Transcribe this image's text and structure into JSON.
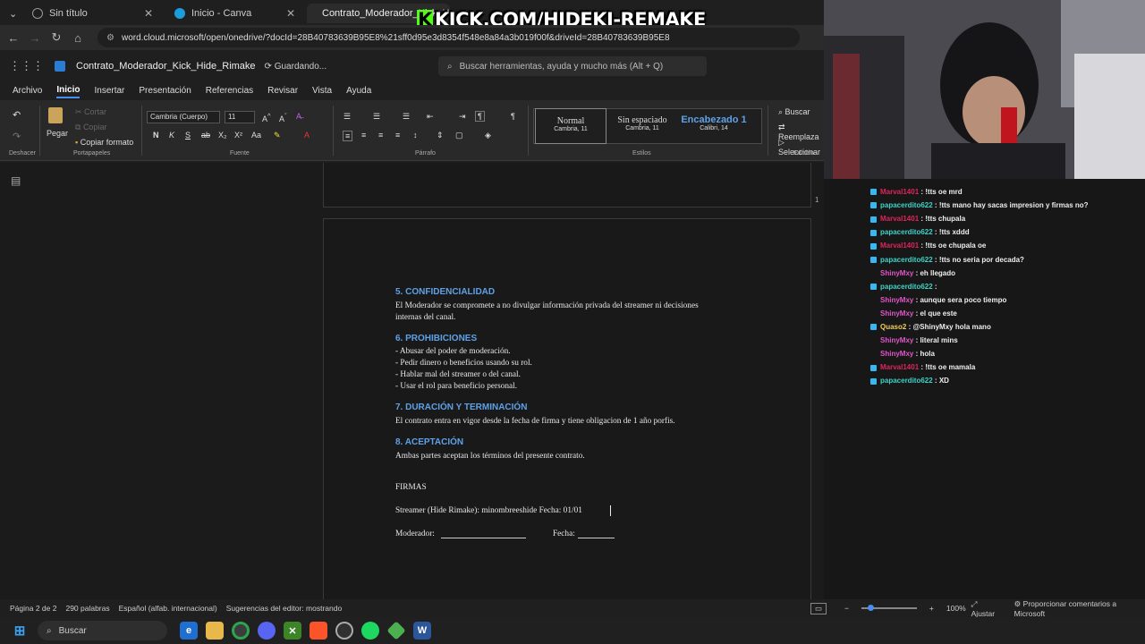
{
  "browser": {
    "tabs": [
      {
        "label": "Sin título",
        "color": "#777"
      },
      {
        "label": "Inicio - Canva",
        "color": "#1c9cdb"
      },
      {
        "label": "Contrato_Moderador_Kick_H",
        "color": "#2b579a"
      }
    ],
    "url": "word.cloud.microsoft/open/onedrive/?docId=28B40783639B95E8%21sff0d95e3d8354f548e8a84a3b019f00f&driveId=28B40783639B95E8",
    "overlay_banner": "KICK.COM/HIDEKI-REMAKE",
    "overlay_k": "K"
  },
  "word": {
    "doc_name": "Contrato_Moderador_Kick_Hide_Rimake",
    "saving": "Guardando...",
    "search_placeholder": "Buscar herramientas, ayuda y mucho más (Alt + Q)",
    "menus": [
      "Archivo",
      "Inicio",
      "Insertar",
      "Presentación",
      "Referencias",
      "Revisar",
      "Vista",
      "Ayuda"
    ],
    "ribbon": {
      "undo_label": "Deshacer",
      "paste": "Pegar",
      "cut": "Cortar",
      "copy": "Copiar",
      "format_painter": "Copiar formato",
      "clipboard_label": "Portapapeles",
      "font_name": "Cambria (Cuerpo)",
      "font_size": "11",
      "font_label": "Fuente",
      "paragraph_label": "Párrafo",
      "styles_label": "Estilos",
      "edit_label": "Edición",
      "styles": [
        {
          "name": "Normal",
          "sub": "Cambria, 11"
        },
        {
          "name": "Sin espaciado",
          "sub": "Cambria, 11"
        },
        {
          "name": "Encabezado 1",
          "sub": "Calibri, 14"
        }
      ],
      "find": "Buscar",
      "replace": "Reemplaza",
      "select": "Seleccionar"
    },
    "page_number": "1",
    "document": {
      "h5": "5. CONFIDENCIALIDAD",
      "p5a": "El Moderador se compromete a no divulgar información privada del streamer ni decisiones",
      "p5b": "internas del canal.",
      "h6": "6. PROHIBICIONES",
      "p6": [
        "- Abusar del poder de moderación.",
        "- Pedir dinero o beneficios usando su rol.",
        "- Hablar mal del streamer o del canal.",
        "- Usar el rol para beneficio personal."
      ],
      "h7": "7. DURACIÓN Y TERMINACIÓN",
      "p7": "El contrato entra en vigor desde la fecha de firma y tiene obligacion de 1 año porfis.",
      "h8": "8. ACEPTACIÓN",
      "p8": "Ambas partes aceptan los términos del presente contrato.",
      "firmas": "FIRMAS",
      "streamer_line": "Streamer (Hide Rimake): minombreeshide   Fecha: 01/01",
      "moderator_label": "Moderador:",
      "date_label": "Fecha:"
    },
    "status": {
      "page": "Página 2 de 2",
      "words": "290 palabras",
      "language": "Español (alfab. internacional)",
      "suggestions": "Sugerencias del editor: mostrando",
      "zoom": "100%",
      "fit": "Ajustar",
      "feedback": "Proporcionar comentarios a Microsoft"
    }
  },
  "taskbar": {
    "search": "Buscar"
  },
  "chat": [
    {
      "user": "Marval1401",
      "text": "!tts oe mrd",
      "color": "#e0245e",
      "badge": true
    },
    {
      "user": "papacerdito622",
      "text": "!tts mano hay sacas impresion y firmas no?",
      "color": "#3fd2c7",
      "badge": true
    },
    {
      "user": "Marval1401",
      "text": "!tts chupala",
      "color": "#e0245e",
      "badge": true
    },
    {
      "user": "papacerdito622",
      "text": "!tts xddd",
      "color": "#3fd2c7",
      "badge": true
    },
    {
      "user": "Marval1401",
      "text": "!tts oe chupala oe",
      "color": "#e0245e",
      "badge": true
    },
    {
      "user": "papacerdito622",
      "text": "!tts no seria por decada?",
      "color": "#3fd2c7",
      "badge": true
    },
    {
      "user": "ShinyMxy",
      "text": "eh llegado",
      "color": "#e056c9",
      "badge": false
    },
    {
      "user": "papacerdito622",
      "text": "",
      "color": "#3fd2c7",
      "badge": true
    },
    {
      "user": "ShinyMxy",
      "text": "aunque sera poco tiempo",
      "color": "#e056c9",
      "badge": false
    },
    {
      "user": "ShinyMxy",
      "text": "el que este",
      "color": "#e056c9",
      "badge": false
    },
    {
      "user": "Quaso2",
      "text": "@ShinyMxy hola mano",
      "color": "#f0d060",
      "badge": true
    },
    {
      "user": "ShinyMxy",
      "text": "literal mins",
      "color": "#e056c9",
      "badge": false
    },
    {
      "user": "ShinyMxy",
      "text": "hola",
      "color": "#e056c9",
      "badge": false
    },
    {
      "user": "Marval1401",
      "text": "!tts oe mamala",
      "color": "#e0245e",
      "badge": true
    },
    {
      "user": "papacerdito622",
      "text": "XD",
      "color": "#3fd2c7",
      "badge": true
    }
  ]
}
